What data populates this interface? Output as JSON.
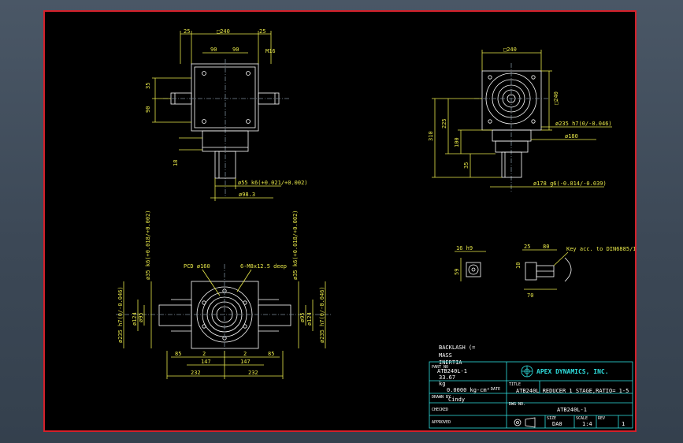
{
  "colors": {
    "background": "#3c4856",
    "sheet": "#000000",
    "border": "#d4202a",
    "dimension": "#e8e84a",
    "outline": "#ffffff",
    "title_block": "#2fe0e0"
  },
  "top_left_view": {
    "dims_top": [
      "25",
      "□240",
      "25"
    ],
    "dims_inner": [
      "90",
      "90",
      "M16"
    ],
    "dims_left": [
      "35",
      "90",
      "18"
    ],
    "shaft_dim": "ø55 k6(+0.021/+0.002)",
    "flange_dim": "ø98.3"
  },
  "top_right_view": {
    "dims_top": "□240",
    "dims_right": "□240",
    "dims_left": [
      "310",
      "225",
      "100",
      "35"
    ],
    "bore_dim": "ø235 h7(0/-0.046)",
    "pilot_dim": "ø180",
    "bottom_dim": "ø178 g6(-0.014/-0.039)"
  },
  "bottom_view": {
    "pcd_label": "PCD ø160",
    "tap_label": "6-M8x12.5 deep",
    "left_dims": [
      "ø35 k6(+0.018/+0.002)",
      "ø235 h7(0/-0.046)",
      "ø124",
      "ø95"
    ],
    "right_dims": [
      "ø35 k6(+0.018/+0.002)",
      "ø235 h7(0/-0.046)",
      "ø124",
      "ø95"
    ],
    "bottom_dims": [
      "85",
      "2",
      "2",
      "85",
      "147",
      "147",
      "232",
      "232"
    ]
  },
  "key_detail": {
    "left_dims": [
      "16 h9",
      "59"
    ],
    "right_dims": [
      "25",
      "80",
      "10",
      "70"
    ],
    "note": "Key acc. to DIN6885/1"
  },
  "notes": {
    "backlash": "BACKLASH (=",
    "mass": "MASS",
    "inertia": "INERTIA"
  },
  "title_block": {
    "part_no_label": "PART NO",
    "part_no": "ATB240L-1",
    "mass_value": "33.67",
    "mass_unit": "kg",
    "inertia_value": "0.0000 kg-cm²",
    "company": "APEX DYNAMICS, INC.",
    "title_label": "TITLE",
    "title": "ATB240L REDUCER 1 STAGE,RATIO= 1-5",
    "drawn_label": "DRAWN BY",
    "drawn_by": "Cindy",
    "date_label": "DATE",
    "checked_label": "CHECKED",
    "approved_label": "APPROVED",
    "dwg_label": "DWG NO.",
    "dwg_no": "ATB240L-1",
    "size_label": "SIZE",
    "size": "DA0",
    "scale_label": "SCALE",
    "scale": "1:4",
    "rev_label": "REV",
    "rev": "1"
  }
}
